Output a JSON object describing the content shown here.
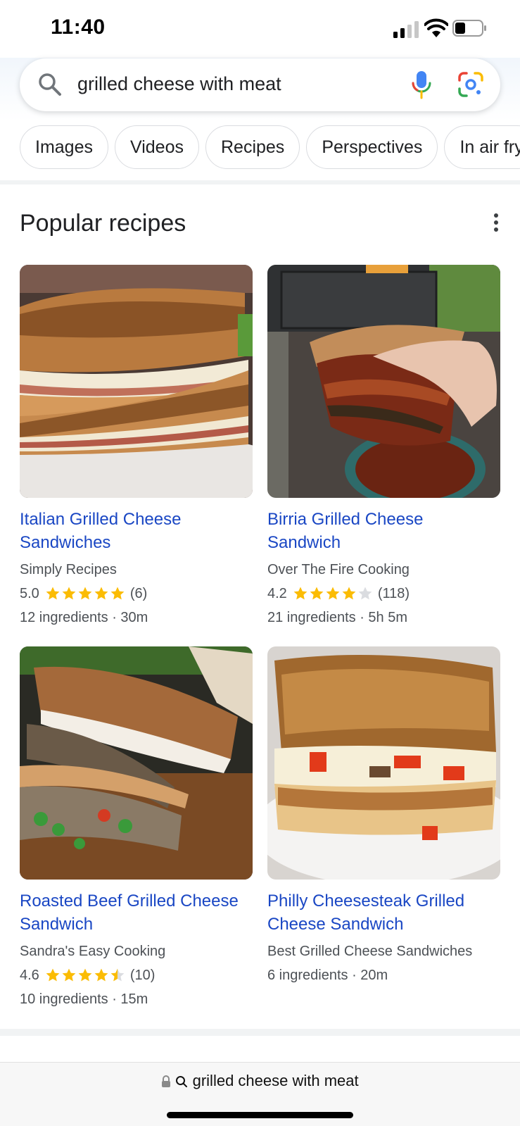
{
  "status_bar": {
    "time": "11:40"
  },
  "search": {
    "query": "grilled cheese with meat"
  },
  "chips": [
    "Images",
    "Videos",
    "Recipes",
    "Perspectives",
    "In air fry"
  ],
  "section": {
    "title": "Popular recipes"
  },
  "recipes": [
    {
      "title": "Italian Grilled Cheese Sandwiches",
      "source": "Simply Recipes",
      "rating": "5.0",
      "stars": 5.0,
      "reviews": "(6)",
      "meta": "12 ingredients · 30m"
    },
    {
      "title": "Birria Grilled Cheese Sandwich",
      "source": "Over The Fire Cooking",
      "rating": "4.2",
      "stars": 4.0,
      "reviews": "(118)",
      "meta": "21 ingredients · 5h 5m"
    },
    {
      "title": "Roasted Beef Grilled Cheese Sandwich",
      "source": "Sandra's Easy Cooking",
      "rating": "4.6",
      "stars": 4.5,
      "reviews": "(10)",
      "meta": "10 ingredients · 15m"
    },
    {
      "title": "Philly Cheesesteak Grilled Cheese Sandwich",
      "source": "Best Grilled Cheese Sandwiches",
      "meta": "6 ingredients · 20m"
    }
  ],
  "url_bar": {
    "text": "grilled cheese with meat"
  },
  "colors": {
    "link": "#1a47c4",
    "star": "#fbbc04",
    "star_empty": "#dadce0"
  }
}
